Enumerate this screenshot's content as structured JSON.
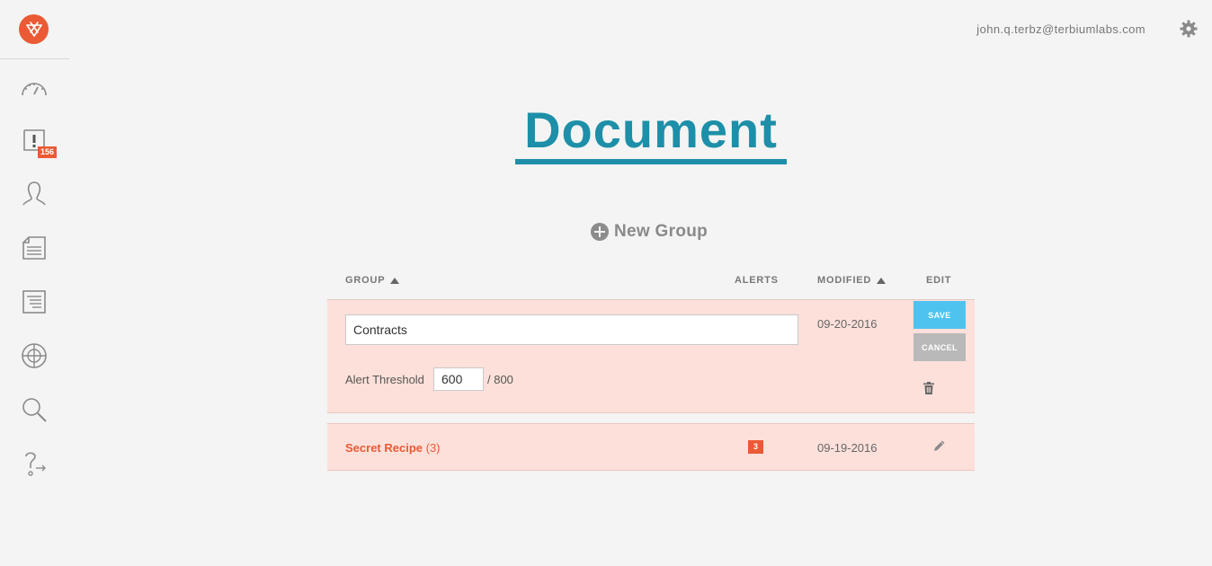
{
  "user": {
    "email": "john.q.terbz@terbiumlabs.com"
  },
  "sidebar": {
    "alerts_badge": "156",
    "items": [
      {
        "icon": "dashboard-gauge-icon"
      },
      {
        "icon": "alert-icon"
      },
      {
        "icon": "user-icon"
      },
      {
        "icon": "document-icon"
      },
      {
        "icon": "list-document-icon"
      },
      {
        "icon": "target-icon"
      },
      {
        "icon": "search-icon"
      },
      {
        "icon": "help-icon"
      }
    ]
  },
  "page": {
    "title": "Document"
  },
  "actions": {
    "new_group_label": "New Group"
  },
  "table": {
    "columns": {
      "group": "GROUP",
      "alerts": "ALERTS",
      "modified": "MODIFIED",
      "edit": "EDIT"
    },
    "edit_row": {
      "name_value": "Contracts",
      "modified": "09-20-2016",
      "threshold_label": "Alert Threshold",
      "threshold_value": "600",
      "threshold_max": "/ 800",
      "save_label": "SAVE",
      "cancel_label": "CANCEL"
    },
    "rows": [
      {
        "name": "Secret Recipe",
        "count": "(3)",
        "alerts": "3",
        "modified": "09-19-2016"
      }
    ]
  },
  "colors": {
    "accent": "#ea5a34",
    "title": "#1d8fa8",
    "save": "#4fc3ef",
    "row_bg": "#fde0da"
  }
}
